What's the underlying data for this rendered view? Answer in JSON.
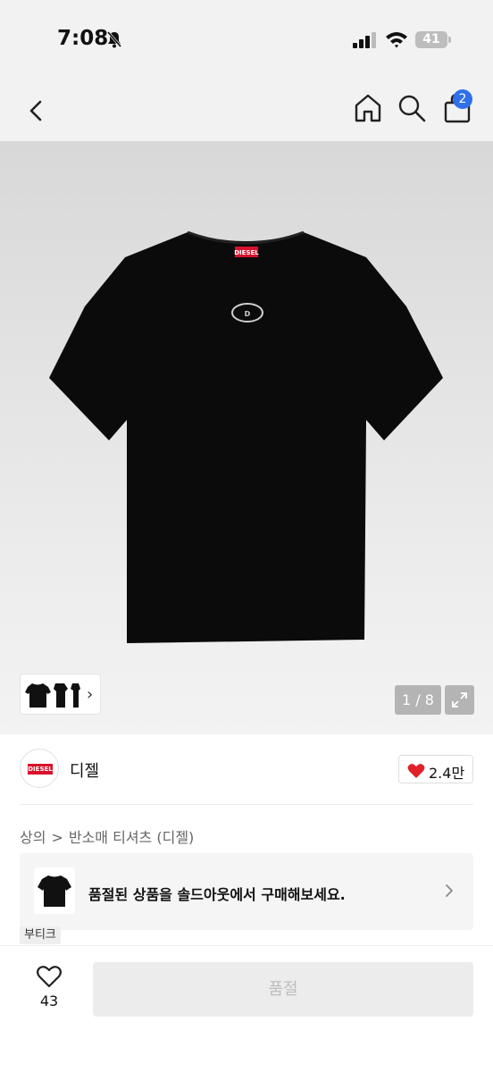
{
  "status_bar": {
    "time": "7:08",
    "battery": "41",
    "icons": [
      "bell-slash-icon",
      "signal-icon",
      "wifi-icon",
      "battery-icon"
    ]
  },
  "nav": {
    "icons": [
      "back-icon",
      "home-icon",
      "search-icon",
      "shopping-bag-icon"
    ],
    "cart_badge": "2"
  },
  "gallery": {
    "page_counter": "1 / 8",
    "thumb_chevron": "›",
    "expand_icon": "expand-icon",
    "logo_text": "DIESEL"
  },
  "brand": {
    "name": "디젤",
    "logo_text": "DIESEL",
    "like_count": "2.4만",
    "like_icon": "heart-filled-icon",
    "like_color": "#e0202a"
  },
  "breadcrumb": {
    "items": [
      "상의",
      "반소매 티셔츠 (디젤)"
    ],
    "separator": ">"
  },
  "soldout_banner": {
    "text": "품절된 상품을 솔드아웃에서 구매해보세요.",
    "tag": "부티크"
  },
  "bottom_bar": {
    "wish_count": "43",
    "wish_icon": "heart-outline-icon",
    "buy_button_label": "품절"
  },
  "colors": {
    "badge_blue": "#2f6fea",
    "diesel_red": "#d7122a",
    "disabled_button": "#ececec"
  }
}
